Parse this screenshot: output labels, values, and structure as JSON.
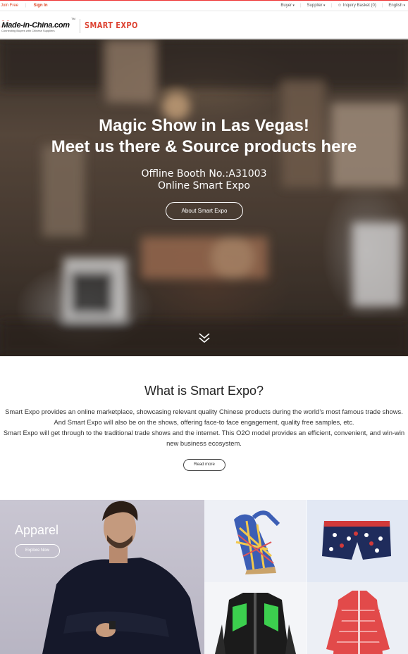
{
  "topbar": {
    "join_free": "Join Free",
    "sign_in": "Sign In",
    "buyer": "Buyer",
    "supplier": "Supplier",
    "inquiry_basket": "Inquiry Basket (0)",
    "language": "English"
  },
  "header": {
    "logo_text": "Made-in-China.com",
    "logo_tm": "TM",
    "logo_tagline": "Connecting Buyers with Chinese Suppliers",
    "smart_expo": "SMART EXPO"
  },
  "hero": {
    "headline_1": "Magic Show in Las Vegas!",
    "headline_2": "Meet us there & Source products here",
    "booth_line_1": "Offline Booth No.:A31003",
    "booth_line_2": "Online Smart Expo",
    "about_button": "About Smart Expo"
  },
  "what_is": {
    "title": "What is Smart Expo?",
    "paragraph_1": "Smart Expo provides an online marketplace, showcasing relevant quality Chinese products during the world’s most famous trade shows. And Smart Expo will also be on the shows, offering face-to face engagement, quality free samples, etc.",
    "paragraph_2": "Smart Expo will get through to the traditional trade shows and the internet. This O2O model provides an efficient, convenient, and win-win new business ecosystem.",
    "read_more": "Read more"
  },
  "category": {
    "name": "Apparel",
    "explore_button": "Explore Now"
  },
  "colors": {
    "brand_red": "#dd3322",
    "hero_overlay": "#3a3029"
  }
}
